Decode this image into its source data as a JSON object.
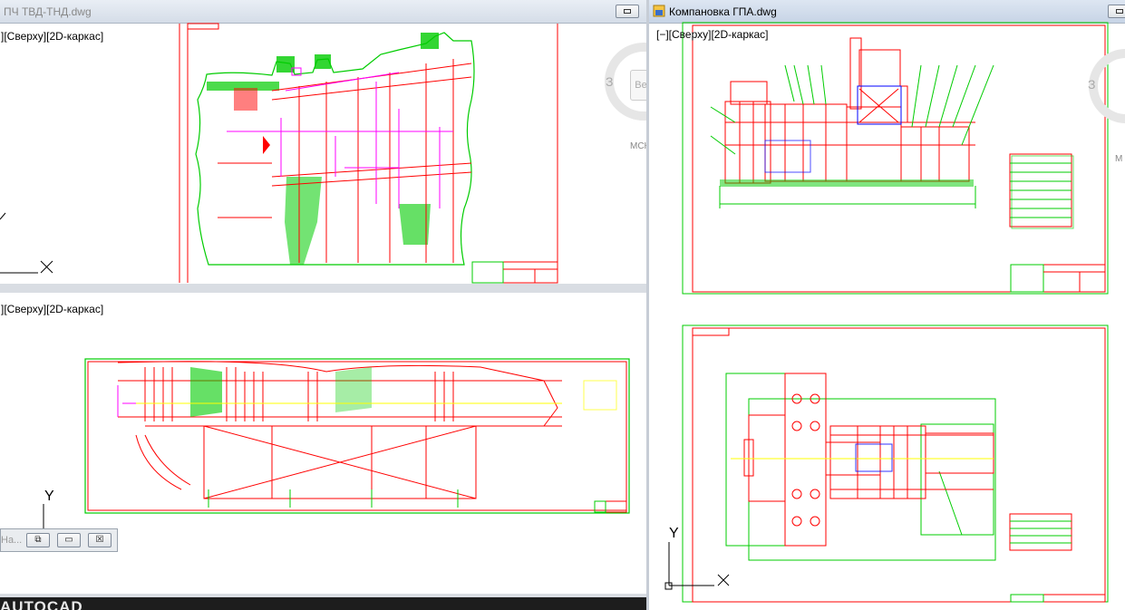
{
  "left_window": {
    "title": "ПЧ ТВД-ТНД.dwg",
    "viewports": {
      "top_label": "][Сверху][2D-каркас]",
      "bottom_label": "][Сверху][2D-каркас]"
    },
    "axis_y": "Y",
    "minimized_title": "На...",
    "buttons": {
      "restore": "⧉",
      "maximize": "▭",
      "close": "☒"
    }
  },
  "right_window": {
    "title": "Компановка ГПА.dwg",
    "viewport_label": "[−][Сверху][2D-каркас]",
    "axis_y": "Y"
  },
  "viewcube": {
    "face": "З",
    "button": "Ве",
    "wcs": "МСК"
  },
  "right_viewcube": {
    "face": "З",
    "wcs": "М"
  },
  "app_logo": "AUTOCAD",
  "colors": {
    "drawing_red": "#ff0000",
    "drawing_green": "#00cc00",
    "drawing_magenta": "#ff00ff",
    "drawing_yellow": "#ffff00",
    "drawing_blue": "#0000ff",
    "background": "#ffffff"
  }
}
